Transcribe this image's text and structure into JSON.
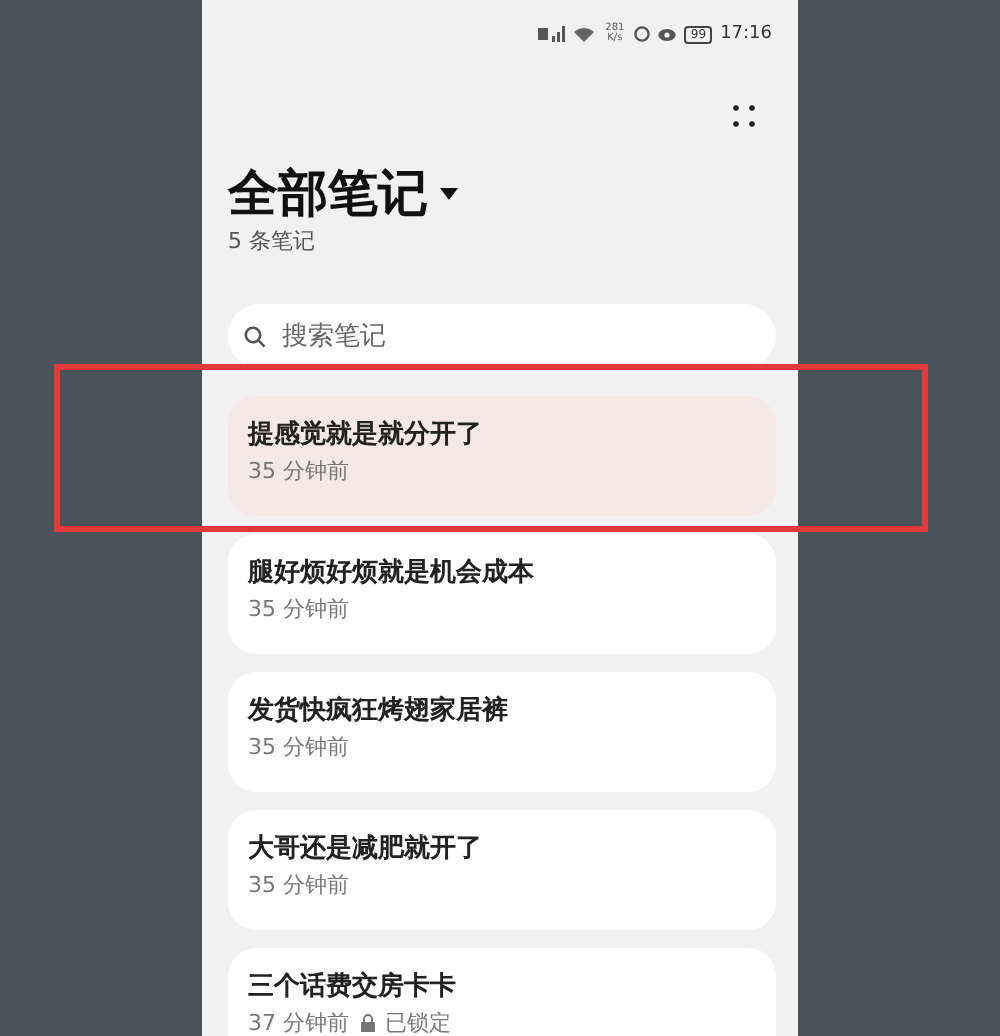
{
  "status_bar": {
    "speed": "281 K/s",
    "battery": "99",
    "time": "17:16"
  },
  "header": {
    "title": "全部笔记",
    "count": "5 条笔记"
  },
  "search": {
    "placeholder": "搜索笔记"
  },
  "notes": [
    {
      "title": "提感觉就是就分开了",
      "meta": "35 分钟前",
      "selected": true,
      "locked": false
    },
    {
      "title": "腿好烦好烦就是机会成本",
      "meta": "35 分钟前",
      "selected": false,
      "locked": false
    },
    {
      "title": "发货快疯狂烤翅家居裤",
      "meta": "35 分钟前",
      "selected": false,
      "locked": false
    },
    {
      "title": "大哥还是减肥就开了",
      "meta": "35 分钟前",
      "selected": false,
      "locked": false
    },
    {
      "title": "三个话费交房卡卡",
      "meta": "37 分钟前",
      "selected": false,
      "locked": true,
      "lock_label": "已锁定"
    }
  ],
  "annotation": {
    "highlight": true
  }
}
